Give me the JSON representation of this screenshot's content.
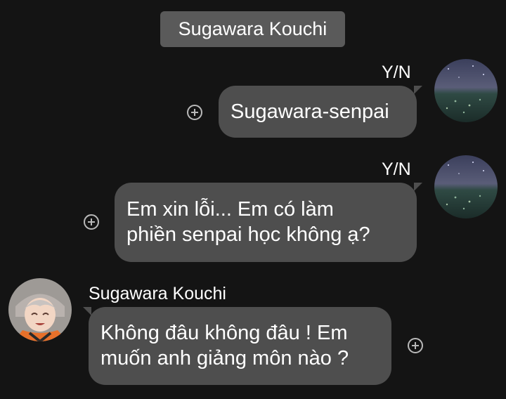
{
  "chat": {
    "title": "Sugawara Kouchi"
  },
  "messages": [
    {
      "sender": "Y/N",
      "side": "right",
      "avatar_icon": "starry-field-avatar",
      "lines": [
        "Sugawara-senpai"
      ]
    },
    {
      "sender": "Y/N",
      "side": "right",
      "avatar_icon": "starry-field-avatar",
      "lines": [
        "Em xin lỗi... Em có làm",
        "phiền senpai học không ạ?"
      ]
    },
    {
      "sender": "Sugawara Kouchi",
      "side": "left",
      "avatar_icon": "anime-character-avatar",
      "lines": [
        "Không đâu không đâu ! Em",
        "muốn anh giảng môn nào ?"
      ]
    }
  ],
  "icons": {
    "reaction": "add-reaction-icon"
  },
  "colors": {
    "background": "#141414",
    "bubble": "#4e4e4e",
    "header": "#5a5a5a",
    "text": "#ffffff"
  }
}
